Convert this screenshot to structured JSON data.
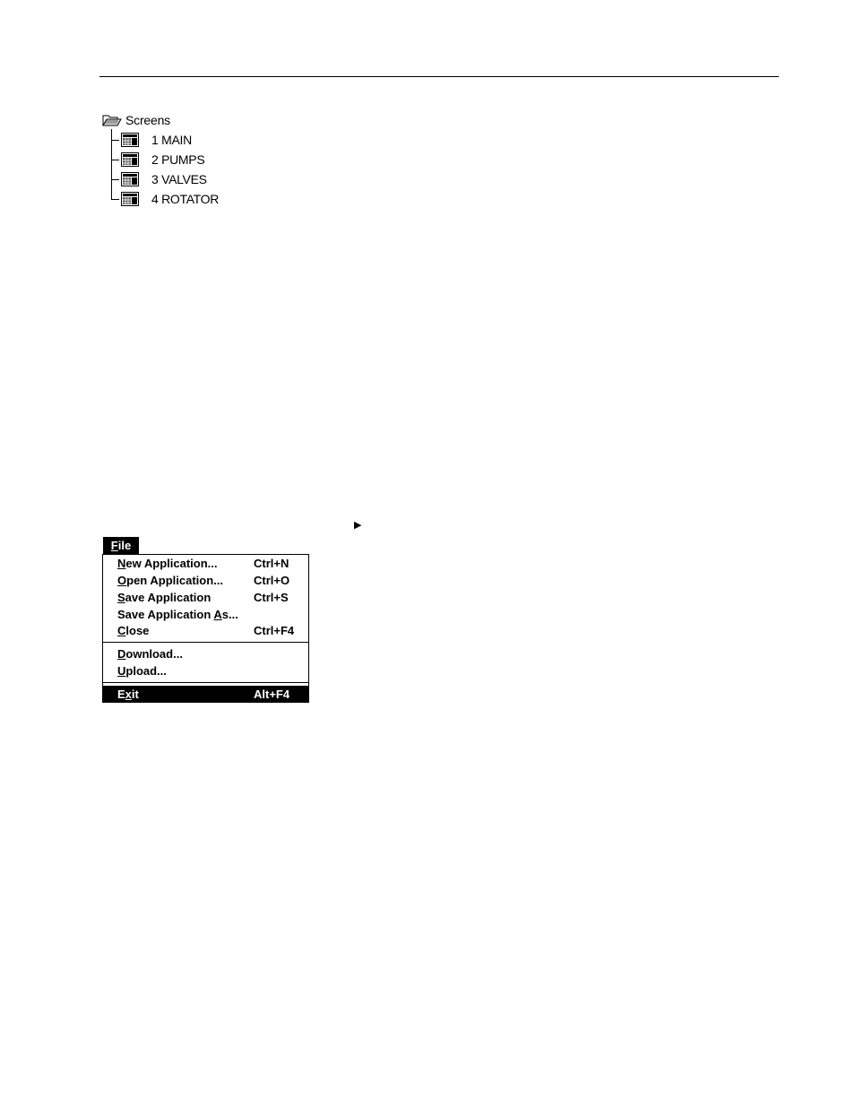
{
  "tree": {
    "root_label": "Screens",
    "items": [
      {
        "label": "1 MAIN"
      },
      {
        "label": "2 PUMPS"
      },
      {
        "label": "3 VALVES"
      },
      {
        "label": "4 ROTATOR"
      }
    ]
  },
  "arrow_marker": "▶",
  "file_menu": {
    "title_key": "F",
    "title_rest": "ile",
    "items": [
      {
        "pre": "",
        "key": "N",
        "post": "ew Application...",
        "shortcut": "Ctrl+N"
      },
      {
        "pre": "",
        "key": "O",
        "post": "pen Application...",
        "shortcut": "Ctrl+O"
      },
      {
        "pre": "",
        "key": "S",
        "post": "ave Application",
        "shortcut": "Ctrl+S"
      },
      {
        "pre": "Save Application ",
        "key": "A",
        "post": "s...",
        "shortcut": ""
      },
      {
        "pre": "",
        "key": "C",
        "post": "lose",
        "shortcut": "Ctrl+F4"
      },
      {
        "pre": "",
        "key": "D",
        "post": "ownload...",
        "shortcut": ""
      },
      {
        "pre": "",
        "key": "U",
        "post": "pload...",
        "shortcut": ""
      },
      {
        "pre": "E",
        "key": "x",
        "post": "it",
        "shortcut": "Alt+F4"
      }
    ]
  }
}
